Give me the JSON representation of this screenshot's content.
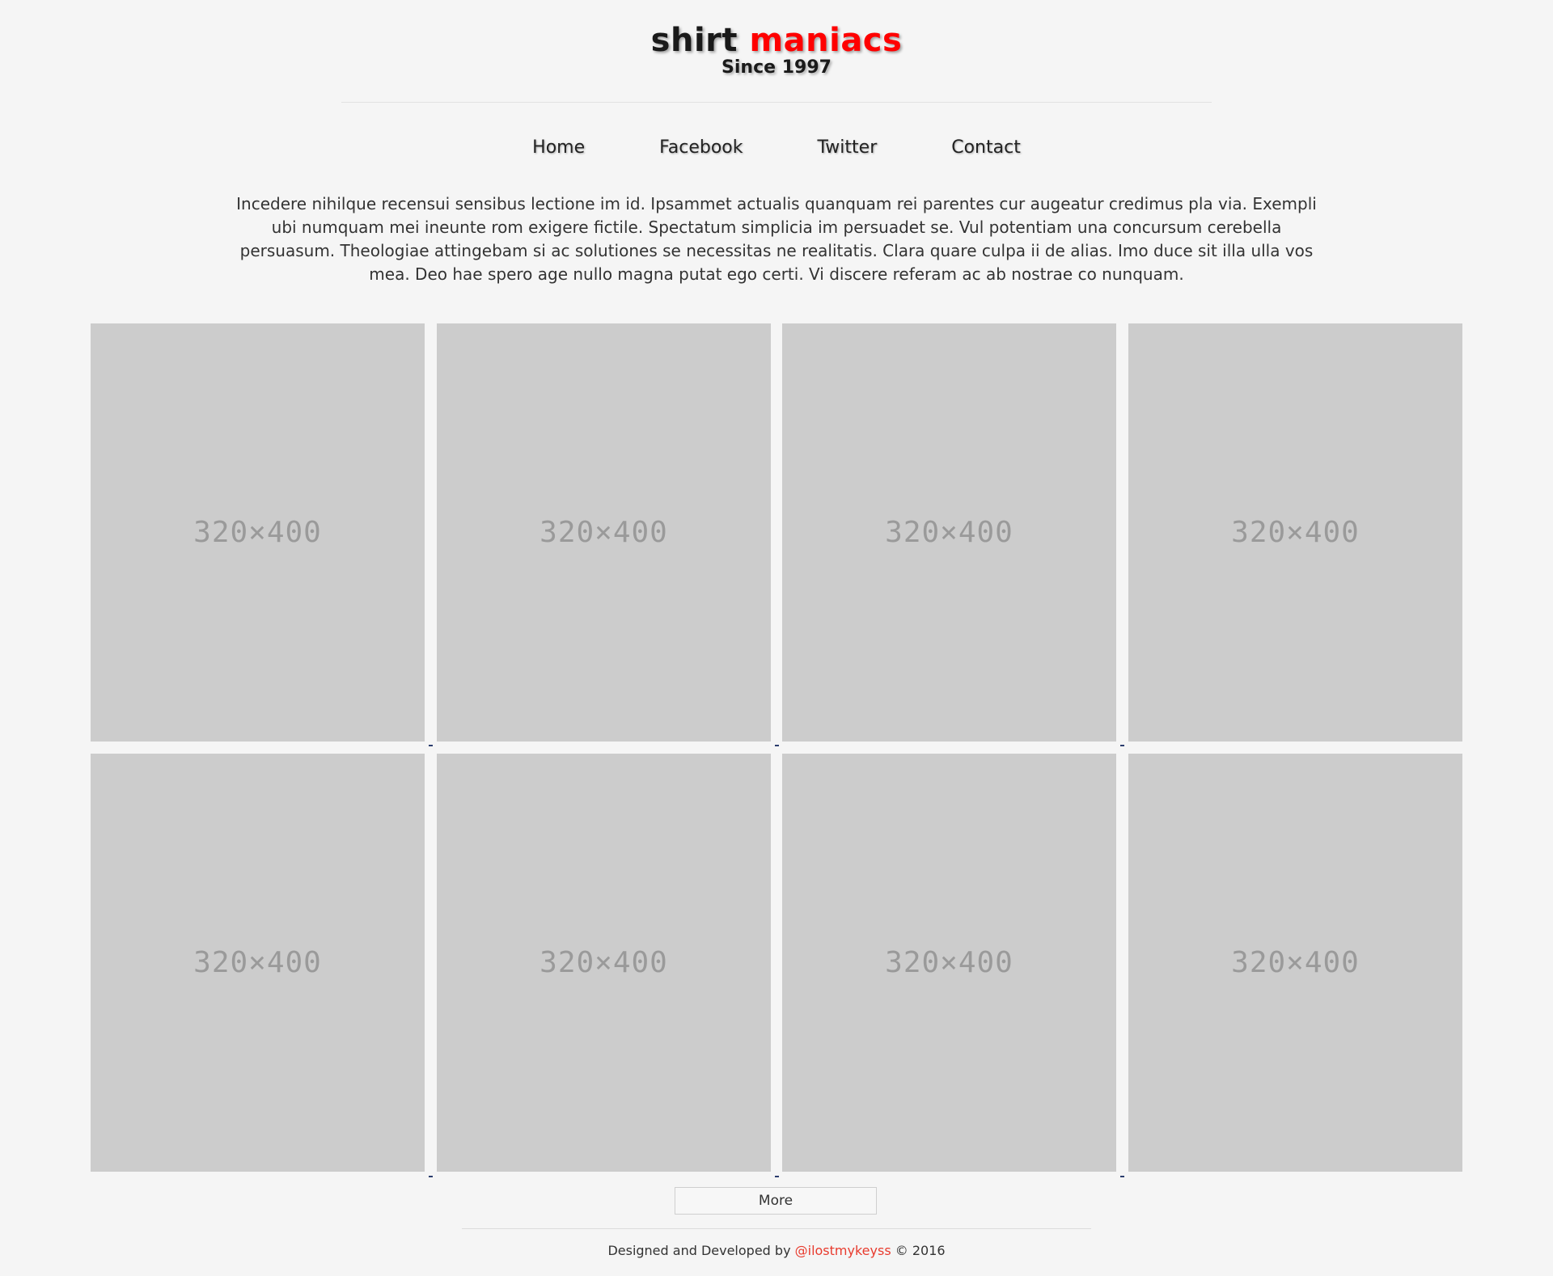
{
  "header": {
    "logo_part1": "shirt",
    "logo_part2": "maniacs",
    "tagline": "Since 1997",
    "accent_color": "#ff0000"
  },
  "nav": {
    "items": [
      {
        "label": "Home"
      },
      {
        "label": "Facebook"
      },
      {
        "label": "Twitter"
      },
      {
        "label": "Contact"
      }
    ]
  },
  "intro": {
    "text": "Incedere nihilque recensui sensibus lectione im id. Ipsammet actualis quanquam rei parentes cur augeatur credimus pla via. Exempli ubi numquam mei ineunte rom exigere fictile. Spectatum simplicia im persuadet se. Vul potentiam una concursum cerebella persuasum. Theologiae attingebam si ac solutiones se necessitas ne realitatis. Clara quare culpa ii de alias. Imo duce sit illa ulla vos mea. Deo hae spero age nullo magna putat ego certi. Vi discere referam ac ab nostrae co nunquam."
  },
  "products": [
    {
      "placeholder": "320×400"
    },
    {
      "placeholder": "320×400"
    },
    {
      "placeholder": "320×400"
    },
    {
      "placeholder": "320×400"
    },
    {
      "placeholder": "320×400"
    },
    {
      "placeholder": "320×400"
    },
    {
      "placeholder": "320×400"
    },
    {
      "placeholder": "320×400"
    }
  ],
  "more_button": {
    "label": "More"
  },
  "footer": {
    "prefix": "Designed and Developed by",
    "author_link": "@ilostmykeyss",
    "suffix": "© 2016",
    "link_color": "#e83b2e"
  }
}
